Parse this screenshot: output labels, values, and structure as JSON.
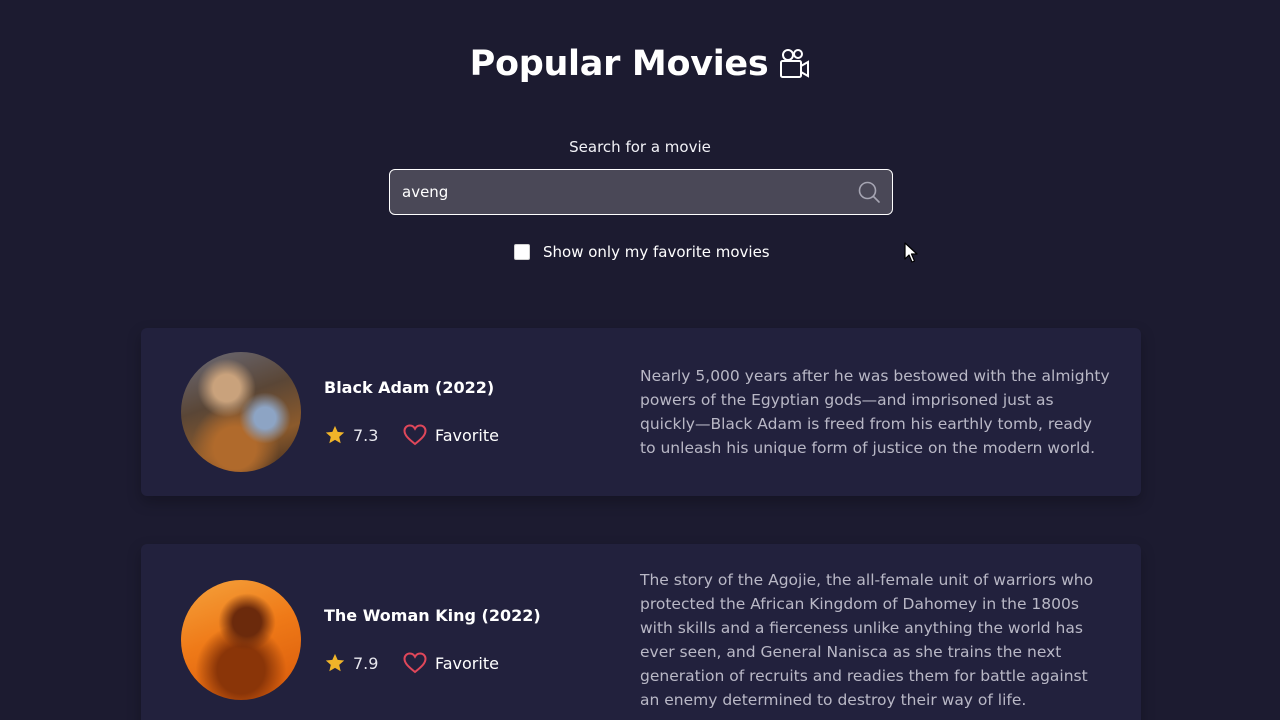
{
  "header": {
    "title": "Popular Movies",
    "icon": "movie-camera-icon"
  },
  "search": {
    "label": "Search for a movie",
    "value": "aveng",
    "placeholder": "",
    "icon": "search-icon"
  },
  "favorites_filter": {
    "label": "Show only my favorite movies",
    "checked": false
  },
  "movies": [
    {
      "title": "Black Adam (2022)",
      "rating": "7.3",
      "favorite_label": "Favorite",
      "favorited": false,
      "overview": "Nearly 5,000 years after he was bestowed with the almighty powers of the Egyptian gods—and imprisoned just as quickly—Black Adam is freed from his earthly tomb, ready to unleash his unique form of justice on the modern world."
    },
    {
      "title": "The Woman King (2022)",
      "rating": "7.9",
      "favorite_label": "Favorite",
      "favorited": false,
      "overview": "The story of the Agojie, the all-female unit of warriors who protected the African Kingdom of Dahomey in the 1800s with skills and a fierceness unlike anything the world has ever seen, and General Nanisca as she trains the next generation of recruits and readies them for battle against an enemy determined to destroy their way of life."
    }
  ],
  "colors": {
    "background": "#1c1b30",
    "card": "#22213d",
    "star": "#f0b429",
    "heart": "#e0475a",
    "search_field": "#4a4857"
  }
}
